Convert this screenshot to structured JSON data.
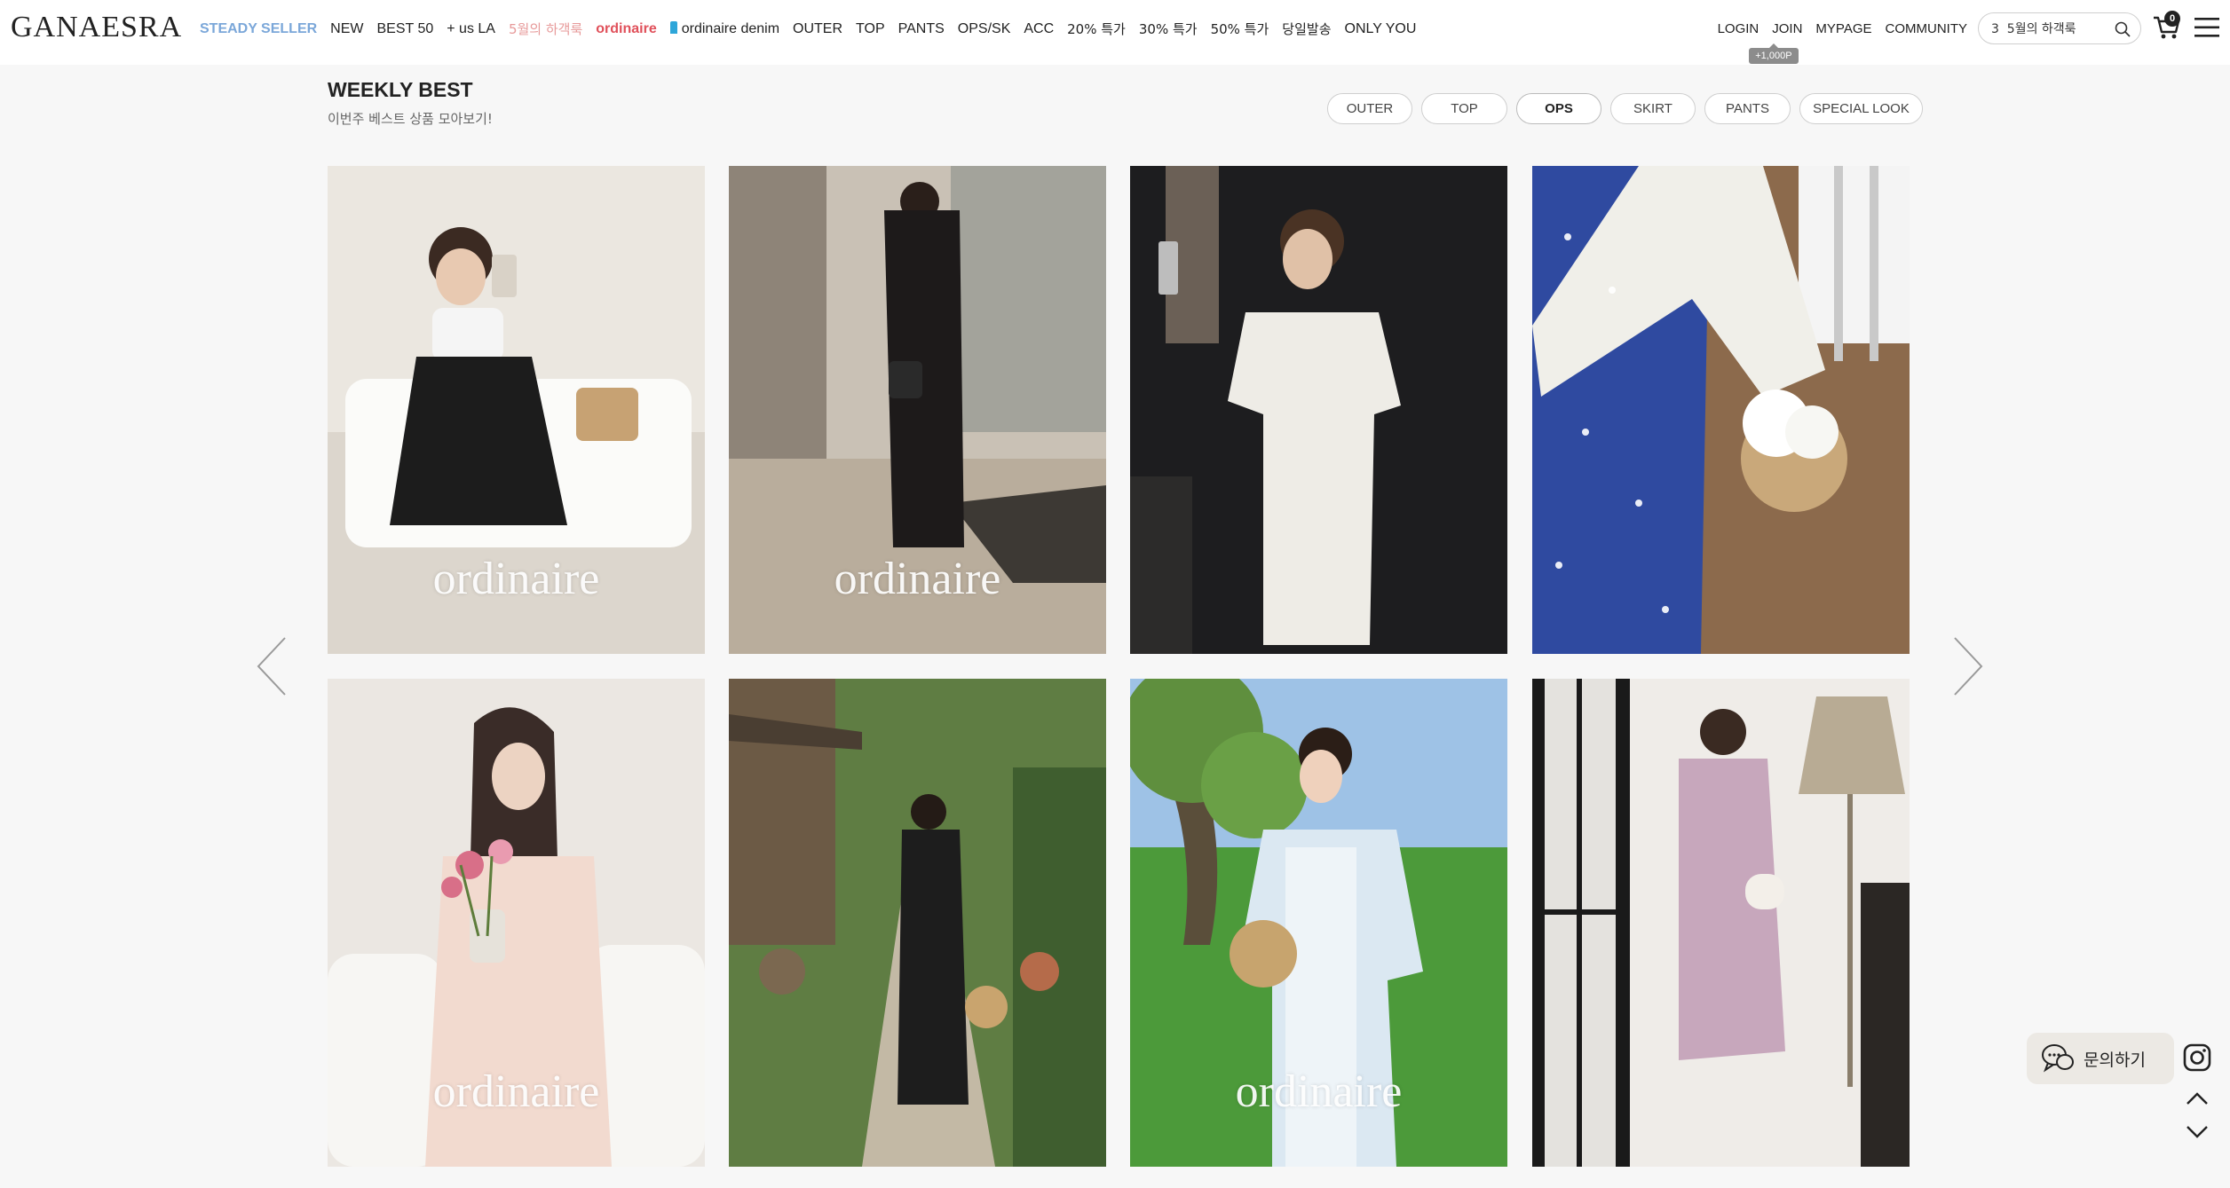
{
  "header": {
    "logo": "GANAESRA",
    "nav": [
      {
        "label": "STEADY SELLER",
        "style": "steady"
      },
      {
        "label": "NEW",
        "style": ""
      },
      {
        "label": "BEST 50",
        "style": ""
      },
      {
        "label": "+ us LA",
        "style": ""
      },
      {
        "label": "5월의 하객룩",
        "style": "pink"
      },
      {
        "label": "ordinaire",
        "style": "red"
      },
      {
        "label": "ordinaire denim",
        "style": "denim"
      },
      {
        "label": "OUTER",
        "style": ""
      },
      {
        "label": "TOP",
        "style": ""
      },
      {
        "label": "PANTS",
        "style": ""
      },
      {
        "label": "OPS/SK",
        "style": ""
      },
      {
        "label": "ACC",
        "style": ""
      },
      {
        "label": "20% 특가",
        "style": ""
      },
      {
        "label": "30% 특가",
        "style": ""
      },
      {
        "label": "50% 특가",
        "style": ""
      },
      {
        "label": "당일발송",
        "style": ""
      },
      {
        "label": "ONLY YOU",
        "style": ""
      }
    ],
    "util": {
      "login": "LOGIN",
      "join": "JOIN",
      "points_badge": "+1,000P",
      "mypage": "MYPAGE",
      "community": "COMMUNITY"
    },
    "search": {
      "value": "3  5월의 하객룩"
    },
    "cart_count": "0",
    "icons": [
      "search-icon",
      "cart-icon",
      "hamburger-menu-icon"
    ]
  },
  "section": {
    "title": "WEEKLY BEST",
    "subtitle": "이번주 베스트 상품 모아보기!",
    "tabs": [
      {
        "label": "OUTER",
        "active": false
      },
      {
        "label": "TOP",
        "active": false
      },
      {
        "label": "OPS",
        "active": true
      },
      {
        "label": "SKIRT",
        "active": false
      },
      {
        "label": "PANTS",
        "active": false
      },
      {
        "label": "SPECIAL LOOK",
        "active": false
      }
    ]
  },
  "products": [
    {
      "watermark": "ordinaire",
      "palette": [
        "#e7e3dc",
        "#ffffff",
        "#1c1c1c",
        "#c8a57a"
      ]
    },
    {
      "watermark": "ordinaire",
      "palette": [
        "#8e8478",
        "#c9c1b5",
        "#1d1a1a",
        "#a3a39b"
      ]
    },
    {
      "watermark": "",
      "palette": [
        "#1d1d1f",
        "#eeece6",
        "#f3f1ea",
        "#6b6056"
      ]
    },
    {
      "watermark": "",
      "palette": [
        "#2f4aa0",
        "#f0efe9",
        "#8c6a4c",
        "#ffffff"
      ]
    },
    {
      "watermark": "ordinaire",
      "palette": [
        "#eae6e1",
        "#f2dacf",
        "#3a2c28",
        "#d86f88"
      ]
    },
    {
      "watermark": "",
      "palette": [
        "#5f7d43",
        "#c3b9a5",
        "#1d1d1d",
        "#7b6850"
      ]
    },
    {
      "watermark": "ordinaire",
      "palette": [
        "#9ec2e6",
        "#4c9a3a",
        "#dbe8f2",
        "#c7a46e"
      ]
    },
    {
      "watermark": "",
      "palette": [
        "#efece8",
        "#c7a7bc",
        "#1a1a1a",
        "#b8ab94"
      ]
    }
  ],
  "floating": {
    "chat_label": "문의하기",
    "icons": [
      "chat-icon",
      "instagram-icon",
      "scroll-up-icon",
      "scroll-down-icon"
    ]
  },
  "carousel_icons": [
    "prev-arrow-icon",
    "next-arrow-icon"
  ]
}
